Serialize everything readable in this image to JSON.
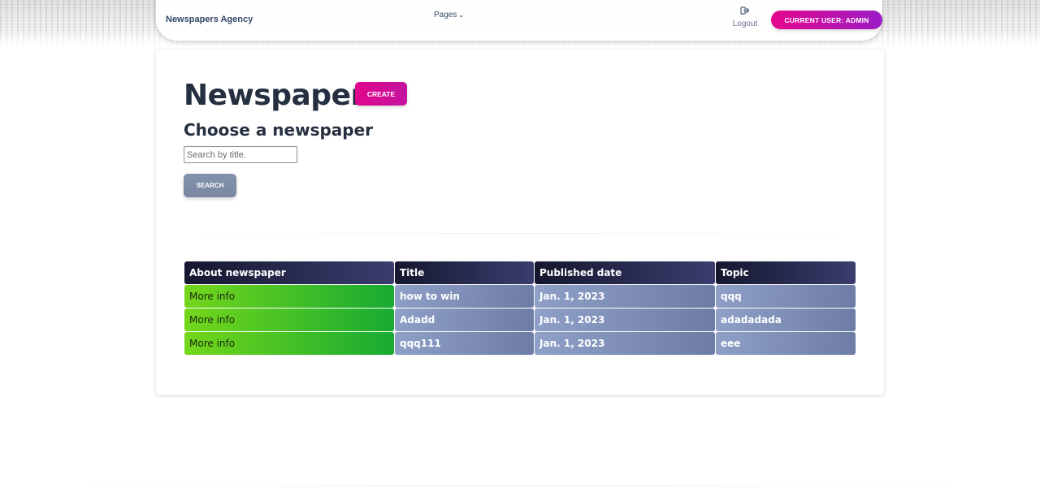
{
  "navbar": {
    "brand": "Newspapers Agency",
    "pages_label": "Pages",
    "logout_label": "Logout",
    "current_user_label": "CURRENT USER: ADMIN"
  },
  "header": {
    "title": "Newspapers",
    "create_label": "CREATE",
    "subtitle": "Choose a newspaper"
  },
  "search": {
    "placeholder": "Search by title.",
    "value": "",
    "button_label": "SEARCH"
  },
  "table": {
    "columns": [
      "About newspaper",
      "Title",
      "Published date",
      "Topic"
    ],
    "rows": [
      {
        "about": "More info",
        "title": "how to win",
        "date": "Jan. 1, 2023",
        "topic": "qqq"
      },
      {
        "about": "More info",
        "title": "Adadd",
        "date": "Jan. 1, 2023",
        "topic": "adadadada"
      },
      {
        "about": "More info",
        "title": "qqq111",
        "date": "Jan. 1, 2023",
        "topic": "eee"
      }
    ]
  },
  "colors": {
    "accent_pink": "#e6068c",
    "accent_purple": "#9b1bc6",
    "header_dark": "#14172e",
    "more_info_green": "#17aa32",
    "cell_slate": "#7a88a3",
    "text_dark": "#252f40"
  },
  "icons": {
    "logout": "sign-out-icon",
    "pages_dropdown": "chevron-down-icon"
  }
}
